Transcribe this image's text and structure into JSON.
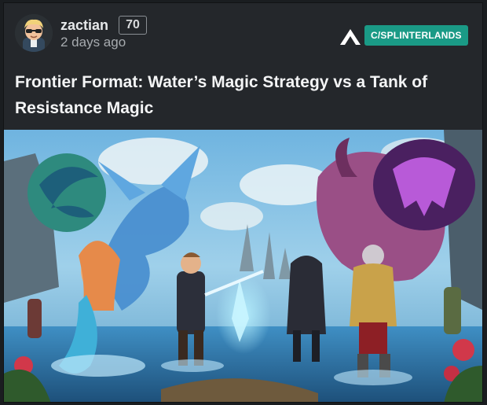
{
  "post": {
    "author": "zactian",
    "reputation": "70",
    "time_ago": "2 days ago",
    "community": "C/SPLINTERLANDS",
    "title": "Frontier Format: Water’s Magic Strategy vs a Tank of Resistance Magic"
  },
  "icons": {
    "community_logo": "splinterlands-logo-icon",
    "avatar": "user-avatar"
  },
  "colors": {
    "card_bg": "#24272b",
    "community_badge": "#1a9a86",
    "text_primary": "#f4f5f6",
    "text_muted": "#a7abaf"
  }
}
